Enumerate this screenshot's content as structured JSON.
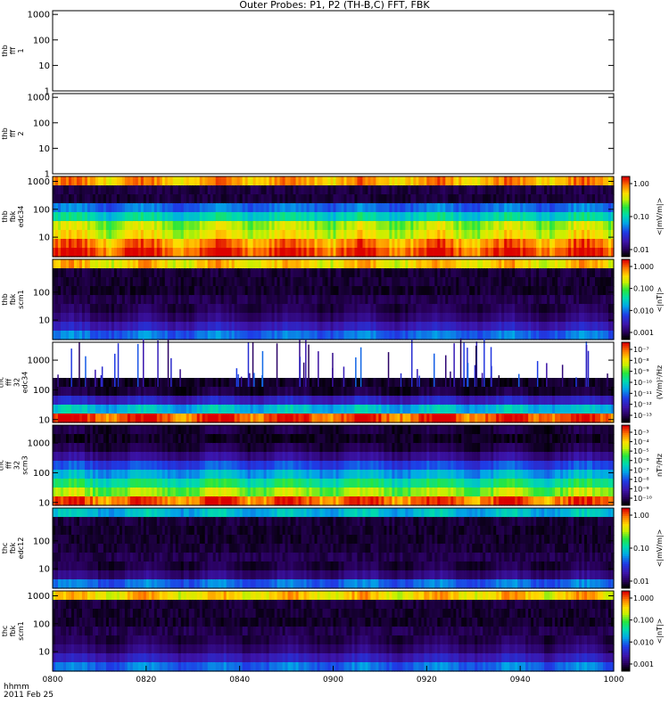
{
  "figure": {
    "title": "Outer Probes: P1, P2 (TH-B,C) FFT, FBK",
    "time_axis": {
      "label": "hhmm",
      "date": "2011 Feb 25",
      "ticks": [
        "0800",
        "0820",
        "0840",
        "0900",
        "0920",
        "0940",
        "1000"
      ]
    }
  },
  "chart_data": [
    {
      "type": "heatmap",
      "ylabel": [
        "thb",
        "fff",
        "1"
      ],
      "yticks": [
        "1000",
        "100",
        "10",
        "1"
      ],
      "ylim": [
        1,
        1400
      ],
      "yscale": "log",
      "empty": true
    },
    {
      "type": "heatmap",
      "ylabel": [
        "thb",
        "fff",
        "2"
      ],
      "yticks": [
        "1000",
        "100",
        "10",
        "1"
      ],
      "ylim": [
        1,
        1400
      ],
      "yscale": "log",
      "empty": true
    },
    {
      "type": "heatmap",
      "ylabel": [
        "thb",
        "fbk",
        "edc34"
      ],
      "yticks": [
        "1000",
        "100",
        "10"
      ],
      "ylim": [
        2,
        1500
      ],
      "yscale": "log",
      "colorbar": {
        "label": "<|mV/m|>",
        "ticks": [
          "1.00",
          "0.10",
          "0.01"
        ],
        "scale": "log"
      },
      "band_levels": [
        0.85,
        0.03,
        0.02,
        0.35,
        0.5,
        0.7,
        0.75,
        0.88,
        0.95
      ]
    },
    {
      "type": "heatmap",
      "ylabel": [
        "thb",
        "fbk",
        "scm1"
      ],
      "yticks": [
        "100",
        "10"
      ],
      "ylim": [
        2,
        1500
      ],
      "yscale": "log",
      "colorbar": {
        "label": "<|nT|>",
        "ticks": [
          "1.000",
          "0.100",
          "0.010",
          "0.001"
        ],
        "scale": "log"
      },
      "band_levels": [
        0.8,
        0.02,
        0.015,
        0.01,
        0.04,
        0.07,
        0.11,
        0.2,
        0.35
      ]
    },
    {
      "type": "heatmap",
      "ylabel": [
        "thc",
        "fff",
        "32",
        "edc34"
      ],
      "yticks": [
        "1000",
        "100",
        "10"
      ],
      "ylim": [
        8,
        4000
      ],
      "yscale": "log",
      "colorbar": {
        "label": "(V/m)²/Hz",
        "ticks": [
          "10⁻⁷",
          "10⁻⁸",
          "10⁻⁹",
          "10⁻¹⁰",
          "10⁻¹¹",
          "10⁻¹²",
          "10⁻¹³"
        ],
        "scale": "log"
      },
      "band_levels": [
        -1,
        -1,
        -1,
        -1,
        0.0,
        0.05,
        0.22,
        0.45,
        0.95
      ]
    },
    {
      "type": "heatmap",
      "ylabel": [
        "thc",
        "fff",
        "32",
        "scm3"
      ],
      "yticks": [
        "1000",
        "100",
        "10"
      ],
      "ylim": [
        8,
        4000
      ],
      "yscale": "log",
      "colorbar": {
        "label": "nT²/Hz",
        "ticks": [
          "10⁻³",
          "10⁻⁴",
          "10⁻⁵",
          "10⁻⁶",
          "10⁻⁷",
          "10⁻⁸",
          "10⁻⁹",
          "10⁻¹⁰"
        ],
        "scale": "log"
      },
      "band_levels": [
        0.05,
        0.0,
        0.06,
        0.14,
        0.3,
        0.42,
        0.55,
        0.68,
        0.92
      ]
    },
    {
      "type": "heatmap",
      "ylabel": [
        "thc",
        "fbk",
        "edc12"
      ],
      "yticks": [
        "100",
        "10"
      ],
      "ylim": [
        2,
        1500
      ],
      "yscale": "log",
      "colorbar": {
        "label": "<|mV/m|>",
        "ticks": [
          "1.00",
          "0.10",
          "0.01"
        ],
        "scale": "log"
      },
      "band_levels": [
        0.45,
        0.02,
        0.01,
        0.01,
        0.02,
        0.04,
        0.06,
        0.12,
        0.35
      ]
    },
    {
      "type": "heatmap",
      "ylabel": [
        "thc",
        "fbk",
        "scm1"
      ],
      "yticks": [
        "1000",
        "100",
        "10"
      ],
      "ylim": [
        2,
        1500
      ],
      "yscale": "log",
      "colorbar": {
        "label": "<|nT|>",
        "ticks": [
          "1.000",
          "0.100",
          "0.010",
          "0.001"
        ],
        "scale": "log"
      },
      "band_levels": [
        0.8,
        0.02,
        0.015,
        0.01,
        0.04,
        0.07,
        0.11,
        0.2,
        0.35
      ]
    }
  ]
}
